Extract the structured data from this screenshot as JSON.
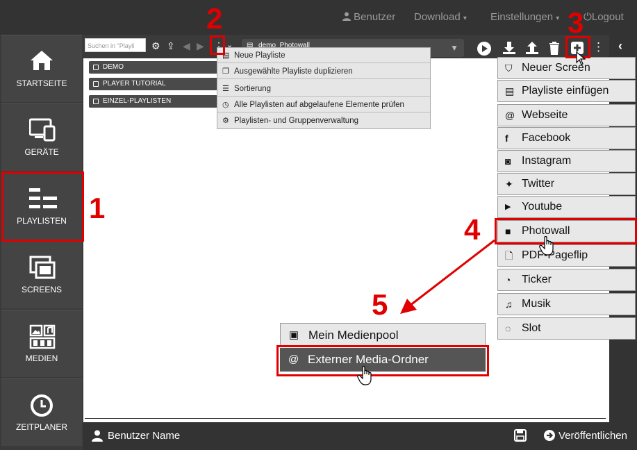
{
  "topnav": {
    "user": "Benutzer",
    "download": "Download",
    "settings": "Einstellungen",
    "logout": "Logout"
  },
  "sidebar": {
    "items": [
      {
        "label": "STARTSEITE",
        "icon": "home-icon"
      },
      {
        "label": "GERÄTE",
        "icon": "devices-icon"
      },
      {
        "label": "PLAYLISTEN",
        "icon": "playlists-icon"
      },
      {
        "label": "SCREENS",
        "icon": "screens-icon"
      },
      {
        "label": "MEDIEN",
        "icon": "media-icon"
      },
      {
        "label": "ZEITPLANER",
        "icon": "clock-icon"
      }
    ]
  },
  "search": {
    "placeholder": "Suchen in \"Playli"
  },
  "playlists": [
    "DEMO",
    "PLAYER TUTORIAL",
    "EINZEL-PLAYLISTEN"
  ],
  "current_playlist": "demo_Photowall",
  "playlist_menu": [
    {
      "label": "Neue Playliste",
      "icon": "list-icon"
    },
    {
      "label": "Ausgewählte Playliste duplizieren",
      "icon": "copy-icon"
    },
    {
      "label": "Sortierung",
      "icon": "sort-icon"
    },
    {
      "label": "Alle Playlisten auf abgelaufene Elemente prüfen",
      "icon": "clock-icon"
    },
    {
      "label": "Playlisten- und Gruppenverwaltung",
      "icon": "gears-icon"
    }
  ],
  "add_menu": [
    {
      "label": "Neuer Screen",
      "icon": "html5-icon"
    },
    {
      "label": "Playliste einfügen",
      "icon": "list-icon"
    },
    {
      "label": "Webseite",
      "icon": "at-icon"
    },
    {
      "label": "Facebook",
      "icon": "facebook-icon"
    },
    {
      "label": "Instagram",
      "icon": "instagram-icon"
    },
    {
      "label": "Twitter",
      "icon": "twitter-icon"
    },
    {
      "label": "Youtube",
      "icon": "youtube-icon"
    },
    {
      "label": "Photowall",
      "icon": "square-icon"
    },
    {
      "label": "PDF-Pageflip",
      "icon": "pdf-icon"
    },
    {
      "label": "Ticker",
      "icon": "rss-icon"
    },
    {
      "label": "Musik",
      "icon": "music-icon"
    },
    {
      "label": "Slot",
      "icon": "circle-notch-icon"
    }
  ],
  "media_menu": [
    {
      "label": "Mein Medienpool",
      "icon": "image-icon"
    },
    {
      "label": "Externer Media-Ordner",
      "icon": "at-icon"
    }
  ],
  "footer": {
    "user": "Benutzer Name",
    "publish": "Veröffentlichen"
  },
  "annotations": [
    "1",
    "2",
    "3",
    "4",
    "5"
  ],
  "colors": {
    "highlight": "#e00000",
    "dark": "#333333",
    "menu": "#e6e6e6"
  }
}
